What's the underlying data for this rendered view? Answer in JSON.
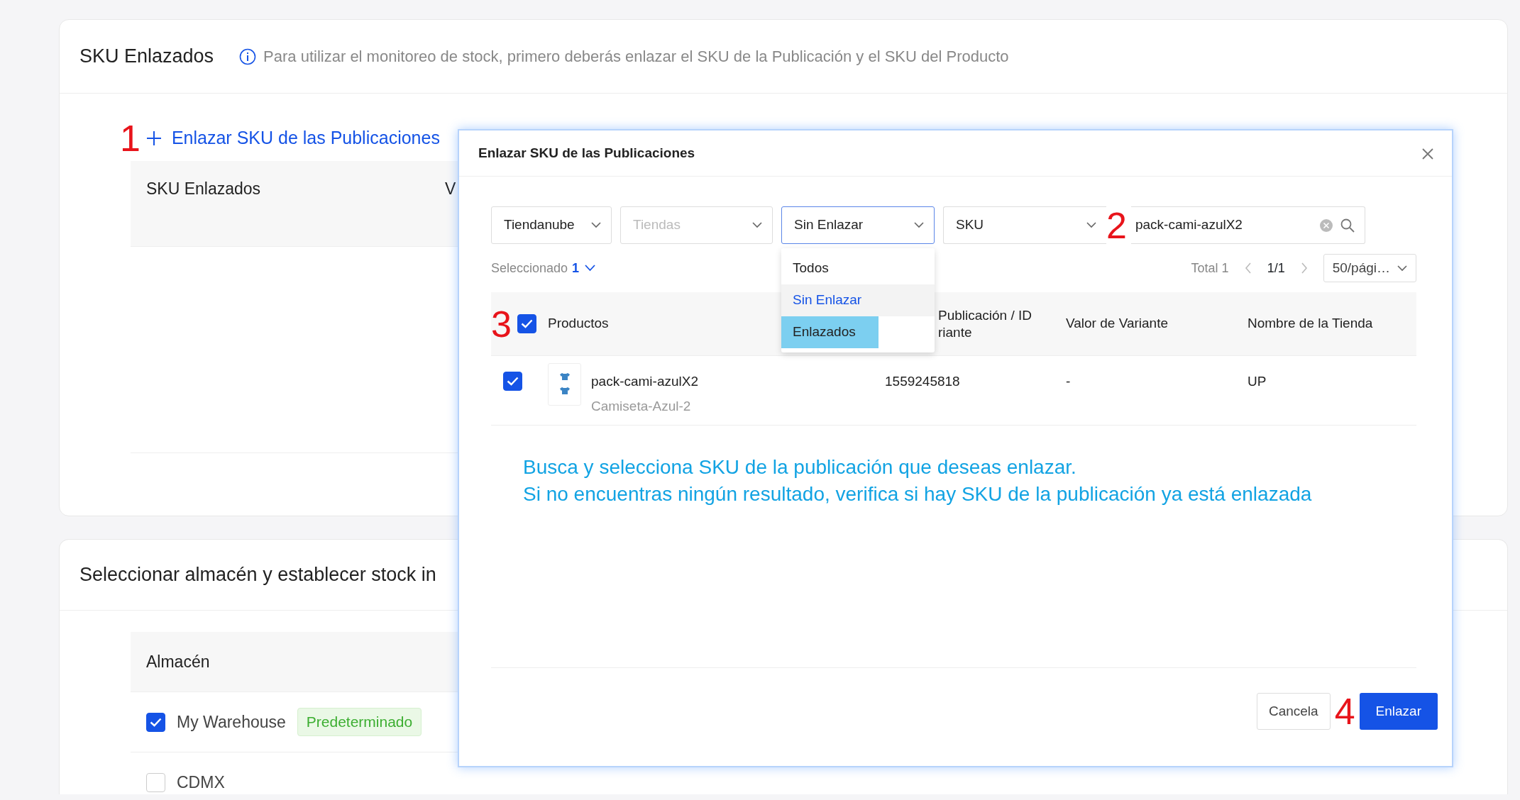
{
  "linked_card": {
    "title": "SKU Enlazados",
    "info": "Para utilizar el monitoreo de stock, primero deberás enlazar el SKU de la Publicación y el SKU del Producto",
    "add_link": "Enlazar SKU de las Publicaciones",
    "table": {
      "columns": [
        "SKU Enlazados",
        "V"
      ]
    }
  },
  "warehouse_card": {
    "title": "Seleccionar almacén y establecer stock in",
    "table": {
      "columns": [
        "Almacén"
      ],
      "rows": [
        {
          "name": "My Warehouse",
          "checked": true,
          "tag": "Predeterminado"
        },
        {
          "name": "CDMX",
          "checked": false
        }
      ]
    }
  },
  "modal": {
    "title": "Enlazar SKU de las Publicaciones",
    "filters": [
      {
        "kind": "select",
        "value": "Tiendanube",
        "open": false
      },
      {
        "kind": "select",
        "placeholder": "Tiendas",
        "open": false
      },
      {
        "kind": "select",
        "value": "Sin Enlazar",
        "open": true
      },
      {
        "kind": "select",
        "value": "SKU",
        "open": false
      },
      {
        "kind": "search",
        "value": "pack-cami-azulX2"
      }
    ],
    "dropdown": {
      "options": [
        {
          "label": "Todos",
          "selected": false,
          "hovered": false
        },
        {
          "label": "Sin Enlazar",
          "selected": true,
          "hovered": false
        },
        {
          "label": "Enlazados",
          "selected": false,
          "hovered": true
        }
      ]
    },
    "selected_label": "Seleccionado",
    "selected_count": "1",
    "total": "Total 1",
    "page": "1/1",
    "page_size": "50/pági…",
    "table": {
      "all_checked": true,
      "columns": [
        "Productos",
        "Publicación / ID riante",
        "Valor de Variante",
        "Nombre de la Tienda"
      ],
      "rows": [
        {
          "checked": true,
          "name": "pack-cami-azulX2",
          "variant": "Camiseta-Azul-2",
          "id": "1559245818",
          "value": "-",
          "store": "UP"
        }
      ]
    },
    "hint": [
      "Busca y selecciona SKU de la publicación que deseas enlazar.",
      "Si no encuentras ningún resultado, verifica si hay SKU de la publicación ya está enlazada"
    ],
    "buttons": [
      {
        "kind": "secondary",
        "label": "Cancela"
      },
      {
        "kind": "primary",
        "label": "Enlazar"
      }
    ]
  },
  "annotations": [
    "1",
    "2",
    "3",
    "4"
  ]
}
